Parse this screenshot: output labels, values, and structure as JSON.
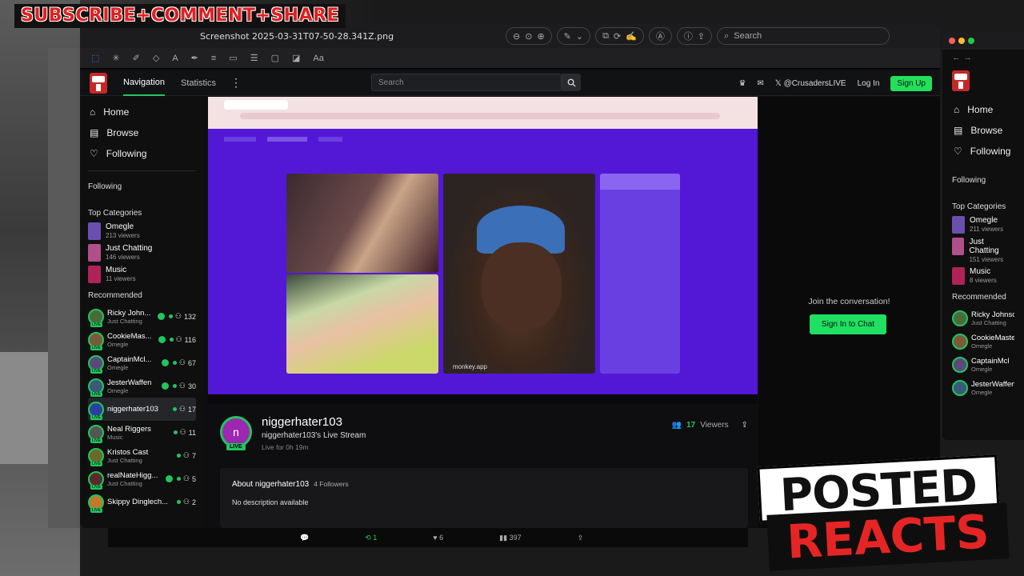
{
  "banner": "SUBSCRIBE+COMMENT+SHARE",
  "window": {
    "filename": "Screenshot 2025-03-31T07-50-28.341Z.png",
    "search_label": "Search"
  },
  "site": {
    "nav_tab_navigation": "Navigation",
    "nav_tab_statistics": "Statistics",
    "search_placeholder": "Search",
    "twitter_handle": "@CrusadersLIVE",
    "login": "Log In",
    "signup": "Sign Up"
  },
  "sidebar": {
    "menu": [
      {
        "label": "Home",
        "icon": "home-icon"
      },
      {
        "label": "Browse",
        "icon": "browse-icon"
      },
      {
        "label": "Following",
        "icon": "heart-icon"
      }
    ],
    "following_heading": "Following",
    "top_categories_heading": "Top Categories",
    "categories": [
      {
        "name": "Omegle",
        "viewers": "213 viewers",
        "color": "#6b4fb0"
      },
      {
        "name": "Just Chatting",
        "viewers": "146 viewers",
        "color": "#b04f8a"
      },
      {
        "name": "Music",
        "viewers": "11 viewers",
        "color": "#b0235a"
      }
    ],
    "recommended_heading": "Recommended",
    "recommended": [
      {
        "name": "Ricky John...",
        "category": "Just Chatting",
        "count": "132",
        "verified": true,
        "avatar": "#4a6a3a"
      },
      {
        "name": "CookieMas...",
        "category": "Omegle",
        "count": "116",
        "verified": true,
        "avatar": "#7a5a3a"
      },
      {
        "name": "CaptainMcl...",
        "category": "Omegle",
        "count": "67",
        "verified": true,
        "avatar": "#5a4a7a"
      },
      {
        "name": "JesterWaffen",
        "category": "Omegle",
        "count": "30",
        "verified": true,
        "avatar": "#3a5a7a"
      },
      {
        "name": "niggerhater103",
        "category": "",
        "count": "17",
        "verified": false,
        "avatar": "#2a3fa0"
      },
      {
        "name": "Neal Riggers",
        "category": "Music",
        "count": "11",
        "verified": false,
        "avatar": "#555555"
      },
      {
        "name": "Kristos Cast",
        "category": "Just Chatting",
        "count": "7",
        "verified": false,
        "avatar": "#6a6a2a"
      },
      {
        "name": "realNateHigg...",
        "category": "Just Chatting",
        "count": "5",
        "verified": true,
        "avatar": "#5a2a2a"
      },
      {
        "name": "Skippy Dinglech...",
        "category": "",
        "count": "2",
        "verified": false,
        "avatar": "#c07a2a"
      }
    ]
  },
  "player": {
    "inner_label": "monkey.app"
  },
  "stream": {
    "avatar_letter": "n",
    "live": "LIVE",
    "streamer": "niggerhater103",
    "title": "niggerhater103's Live Stream",
    "live_for": "Live for 0h 19m",
    "viewers_count": "17",
    "viewers_label": "Viewers"
  },
  "about": {
    "title": "About niggerhater103",
    "followers": "4 Followers",
    "description": "No description available"
  },
  "chat": {
    "join_text": "Join the conversation!",
    "sign_in": "Sign In to Chat"
  },
  "win2": {
    "menu": [
      "Home",
      "Browse",
      "Following"
    ],
    "following_heading": "Following",
    "top_categories_heading": "Top Categories",
    "categories": [
      {
        "name": "Omegle",
        "viewers": "211 viewers"
      },
      {
        "name": "Just Chatting",
        "viewers": "151 viewers"
      },
      {
        "name": "Music",
        "viewers": "8 viewers"
      }
    ],
    "recommended_heading": "Recommended",
    "recommended": [
      {
        "name": "Ricky Johnson",
        "category": "Just Chatting"
      },
      {
        "name": "CookieMaster",
        "category": "Omegle"
      },
      {
        "name": "CaptainMcl",
        "category": "Omegle"
      },
      {
        "name": "JesterWaffen",
        "category": "Omegle"
      }
    ]
  },
  "bottom_bar": {
    "reposts": "1",
    "likes": "6",
    "views": "397"
  },
  "watermark": {
    "line1": "POSTED",
    "line2": "REACTS"
  }
}
